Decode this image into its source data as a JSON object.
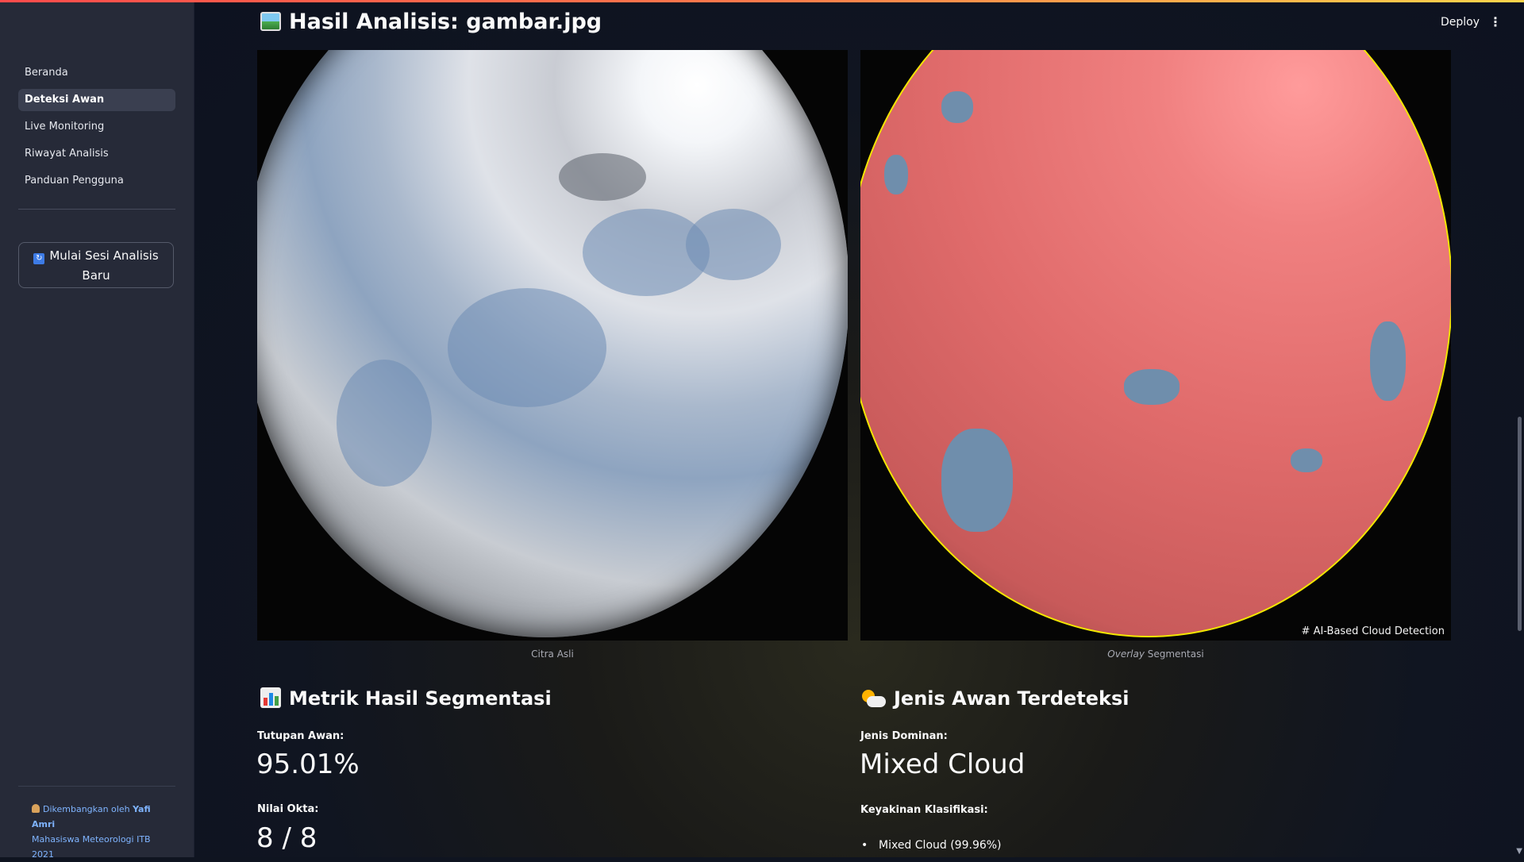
{
  "sidebar": {
    "items": [
      {
        "label": "Beranda"
      },
      {
        "label": "Deteksi Awan"
      },
      {
        "label": "Live Monitoring"
      },
      {
        "label": "Riwayat Analisis"
      },
      {
        "label": "Panduan Pengguna"
      }
    ],
    "active_index": 1,
    "new_session_button": "Mulai Sesi Analisis Baru",
    "footer": {
      "line1_prefix": "Dikembangkan oleh ",
      "author": "Yafi Amri",
      "line2": "Mahasiswa Meteorologi ITB 2021"
    }
  },
  "header": {
    "deploy_label": "Deploy",
    "menu_icon": "kebab-menu-icon"
  },
  "main": {
    "title": "Hasil Analisis: gambar.jpg",
    "images": {
      "original_caption": "Citra Asli",
      "overlay_caption_italic": "Overlay",
      "overlay_caption_rest": " Segmentasi",
      "overlay_badge": "# AI-Based Cloud Detection"
    },
    "metrics": {
      "title": "Metrik Hasil Segmentasi",
      "cover_label": "Tutupan Awan:",
      "cover_value": "95.01%",
      "okta_label": "Nilai Okta:",
      "okta_value": "8 / 8"
    },
    "cloud_type": {
      "title": "Jenis Awan Terdeteksi",
      "dominant_label": "Jenis Dominan:",
      "dominant_value": "Mixed Cloud",
      "confidence_label": "Keyakinan Klasifikasi:",
      "confidence_items": [
        "Mixed Cloud (99.96%)"
      ]
    }
  },
  "colors": {
    "accent_gradient": [
      "#ff4b4b",
      "#ffd54b"
    ],
    "overlay_red": "#e06b6b",
    "outline_yellow": "#f2e600",
    "link_blue": "#7fb4ff"
  }
}
